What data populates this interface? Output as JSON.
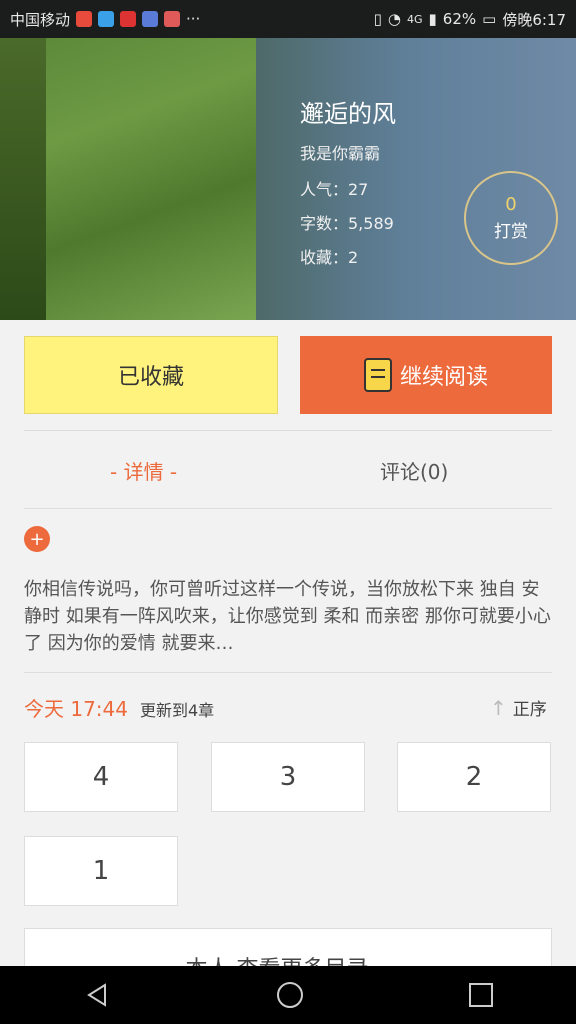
{
  "status_bar": {
    "carrier": "中国移动",
    "signal": "4G",
    "battery": "62%",
    "time": "傍晚6:17",
    "dots": "···"
  },
  "book": {
    "title": "邂逅的风",
    "author": "我是你霸霸",
    "popularity": "人气：27",
    "word_count": "字数：5,589",
    "favorites": "收藏：2"
  },
  "reward": {
    "count": "0",
    "label": "打赏"
  },
  "actions": {
    "favorited_label": "已收藏",
    "continue_label": "继续阅读"
  },
  "tabs": {
    "detail": "- 详情 -",
    "comment": "评论(0)"
  },
  "description": "你相信传说吗，你可曾听过这样一个传说，当你放松下来 独自 安静时 如果有一阵风吹来，让你感觉到 柔和 而亲密 那你可就要小心了 因为你的爱情 就要来…",
  "update": {
    "time": "今天 17:44",
    "text": "更新到4章",
    "sort_label": "正序"
  },
  "chapters": [
    "4",
    "3",
    "2",
    "1"
  ],
  "more_label": "本人 查看更多目录…",
  "colors": {
    "accent": "#ec6a3c",
    "favorite_bg": "#fff37e",
    "reward_ring": "#d9c58a"
  }
}
